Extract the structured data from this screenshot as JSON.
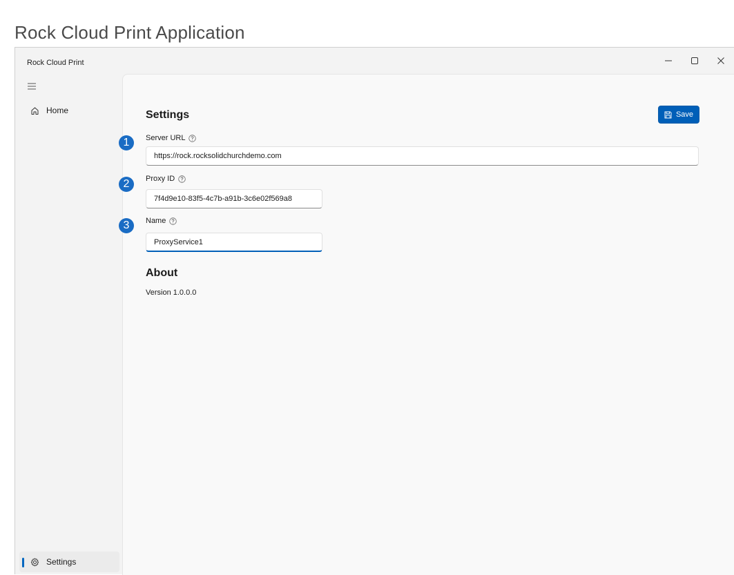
{
  "page": {
    "heading": "Rock Cloud Print Application"
  },
  "window": {
    "title": "Rock Cloud Print"
  },
  "window_controls": {
    "minimize_icon": "minimize-icon",
    "maximize_icon": "maximize-icon",
    "close_icon": "close-icon"
  },
  "sidebar": {
    "menu_icon": "hamburger-icon",
    "items": [
      {
        "label": "Home",
        "icon": "home-icon",
        "selected": false
      },
      {
        "label": "Settings",
        "icon": "gear-icon",
        "selected": true
      }
    ]
  },
  "settings": {
    "title": "Settings",
    "save_label": "Save",
    "fields": [
      {
        "label": "Server URL",
        "value": "https://rock.rocksolidchurchdemo.com"
      },
      {
        "label": "Proxy ID",
        "value": "7f4d9e10-83f5-4c7b-a91b-3c6e02f569a8"
      },
      {
        "label": "Name",
        "value": "ProxyService1"
      }
    ]
  },
  "about": {
    "title": "About",
    "version": "Version 1.0.0.0"
  },
  "callouts": [
    "1",
    "2",
    "3"
  ],
  "colors": {
    "accent": "#005fb8",
    "callout": "#1a6cc4",
    "content_bg": "#f9f9f9",
    "sidebar_bg": "#f3f3f3"
  }
}
